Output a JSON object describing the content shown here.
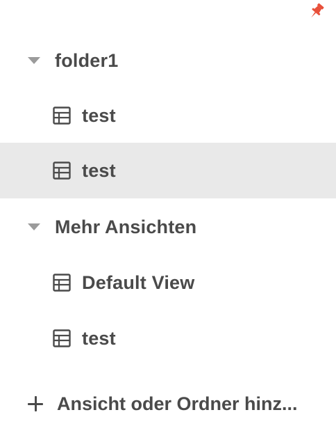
{
  "pin": {
    "icon": "pin-icon",
    "color": "#e8503a"
  },
  "tree": {
    "folders": [
      {
        "label": "folder1",
        "icon": "caret-down-icon",
        "views": [
          {
            "label": "test",
            "icon": "grid-view-icon",
            "selected": false
          },
          {
            "label": "test",
            "icon": "grid-view-icon",
            "selected": true
          }
        ]
      },
      {
        "label": "Mehr Ansichten",
        "icon": "caret-down-icon",
        "views": [
          {
            "label": "Default View",
            "icon": "grid-view-icon",
            "selected": false
          },
          {
            "label": "test",
            "icon": "grid-view-icon",
            "selected": false
          }
        ]
      }
    ]
  },
  "add_action": {
    "label": "Ansicht oder Ordner hinz...",
    "icon": "plus-icon"
  },
  "colors": {
    "selected_bg": "#e9e9e9",
    "text": "#4a4a4a",
    "caret": "#9b9b9b"
  }
}
